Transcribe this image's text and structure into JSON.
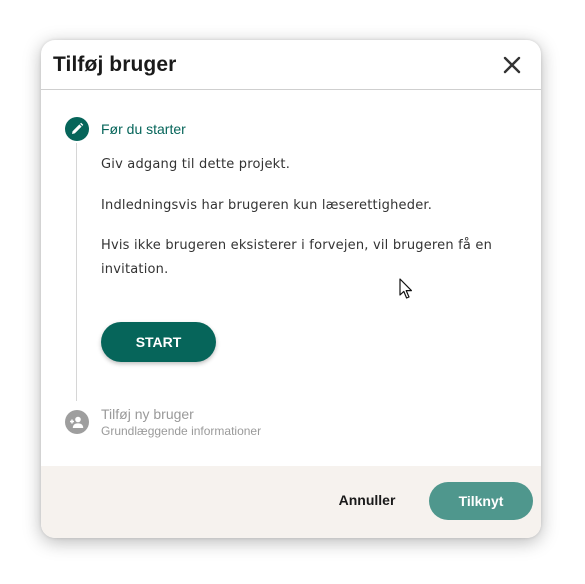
{
  "dialog": {
    "title": "Tilføj bruger",
    "close_icon": "close-icon"
  },
  "stepper": {
    "steps": [
      {
        "title": "Før du starter",
        "icon": "pencil-icon",
        "state": "active",
        "paragraphs": [
          "Giv adgang til dette projekt.",
          "Indledningsvis har brugeren kun læserettigheder.",
          "Hvis ikke brugeren eksisterer i forvejen, vil brugeren få en",
          "invitation."
        ],
        "start_label": "START"
      },
      {
        "title": "Tilføj ny bruger",
        "subtitle": "Grundlæggende informationer",
        "icon": "add-user-icon",
        "state": "inactive"
      }
    ]
  },
  "footer": {
    "cancel_label": "Annuller",
    "attach_label": "Tilknyt"
  },
  "colors": {
    "primary": "#06655a",
    "primary_muted": "#4f978d",
    "inactive": "#9e9e9e",
    "footer_bg": "#f6f2ee"
  }
}
